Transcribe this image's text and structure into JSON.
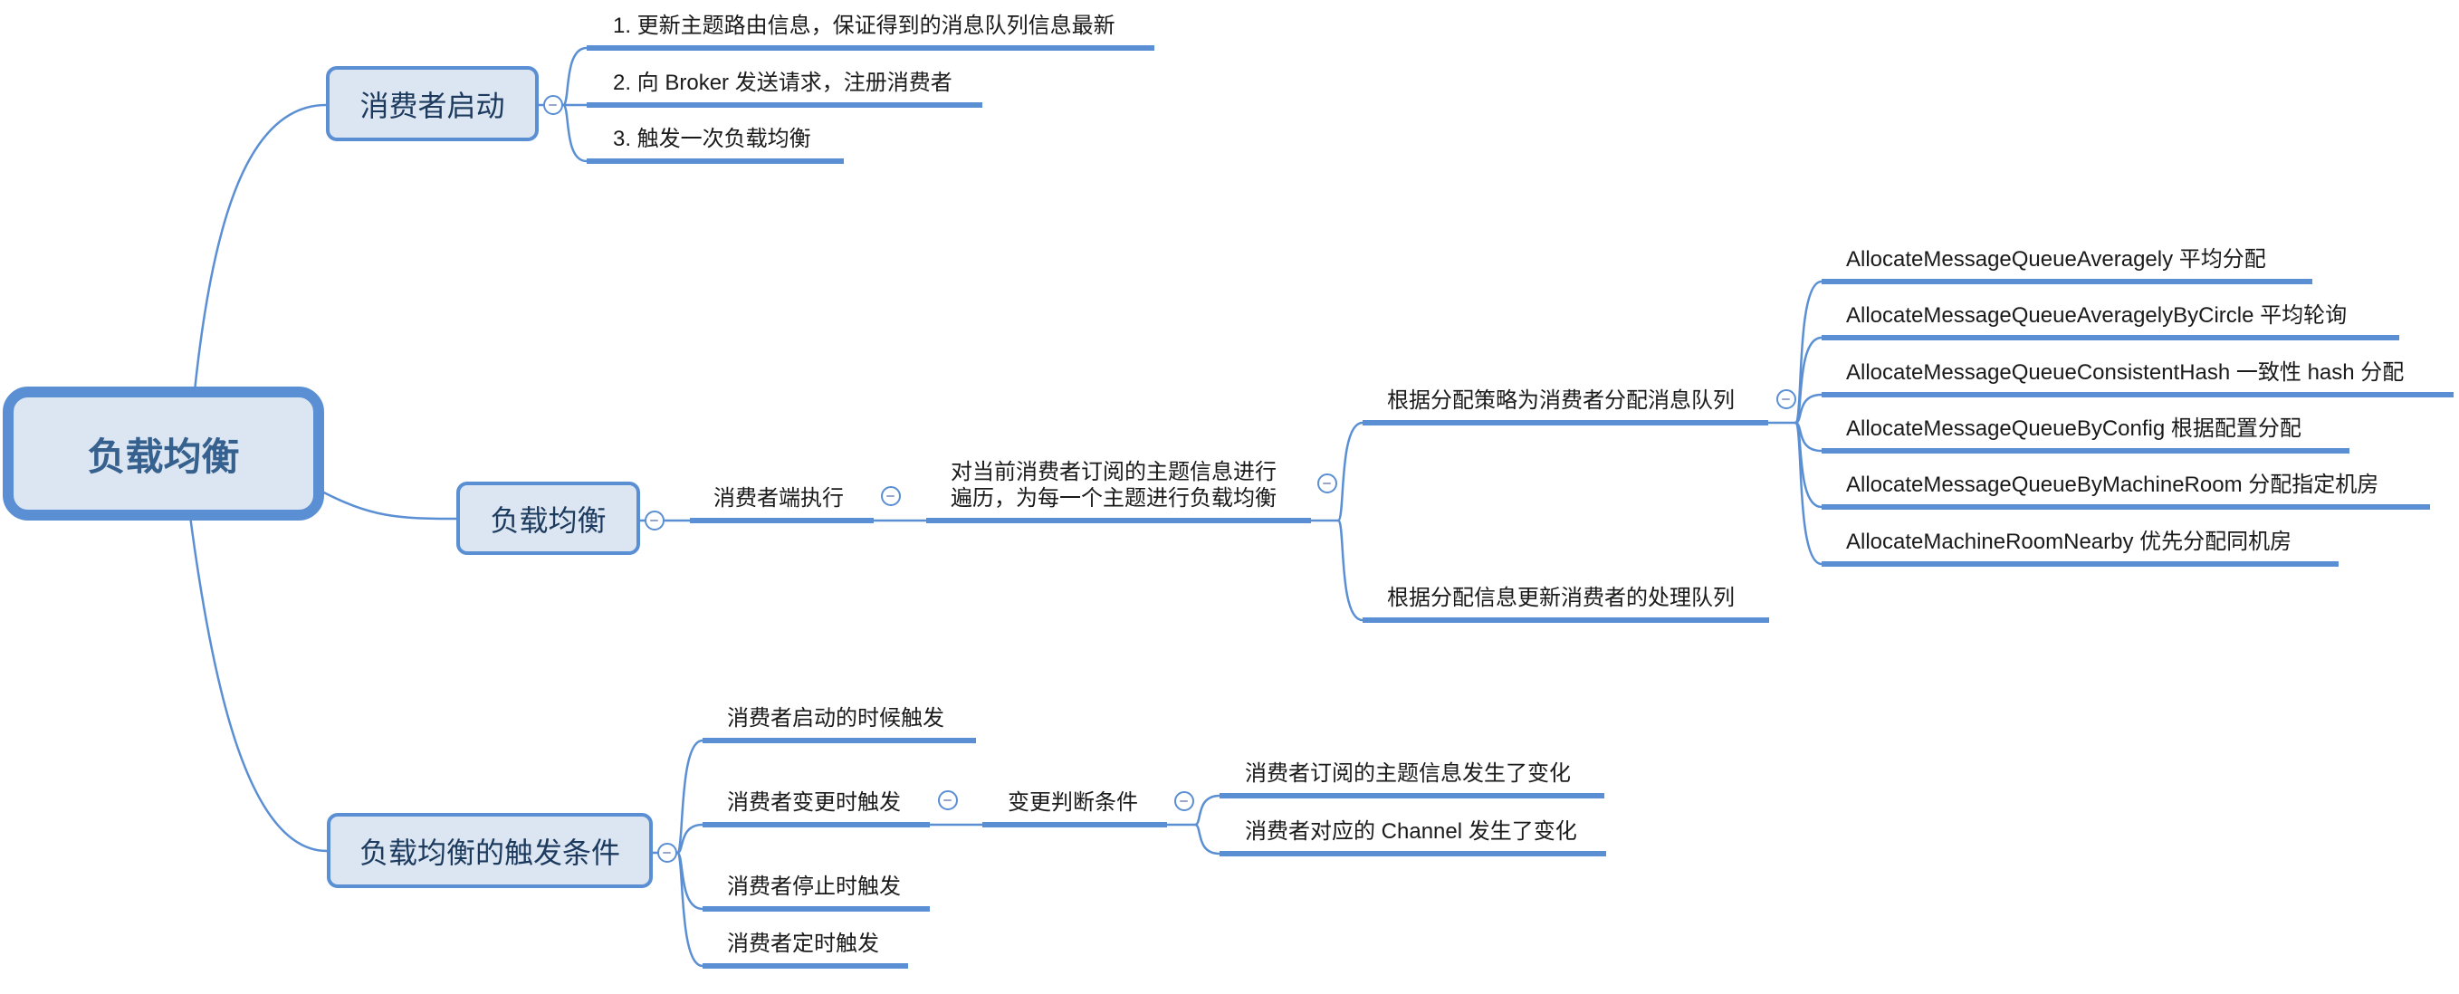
{
  "mindmap": {
    "root": {
      "label": "负载均衡"
    },
    "consumer_startup": {
      "label": "消费者启动",
      "steps": [
        "1. 更新主题路由信息，保证得到的消息队列信息最新",
        "2. 向 Broker 发送请求，注册消费者",
        "3. 触发一次负载均衡"
      ]
    },
    "load_balancing": {
      "label": "负载均衡",
      "executor": "消费者端执行",
      "traverse_lines": [
        "对当前消费者订阅的主题信息进行",
        "遍历，为每一个主题进行负载均衡"
      ],
      "allocate": {
        "label": "根据分配策略为消费者分配消息队列",
        "strategies": [
          "AllocateMessageQueueAveragely 平均分配",
          "AllocateMessageQueueAveragelyByCircle 平均轮询",
          "AllocateMessageQueueConsistentHash 一致性 hash 分配",
          "AllocateMessageQueueByConfig 根据配置分配",
          "AllocateMessageQueueByMachineRoom 分配指定机房",
          "AllocateMachineRoomNearby 优先分配同机房"
        ]
      },
      "update": "根据分配信息更新消费者的处理队列"
    },
    "triggers": {
      "label": "负载均衡的触发条件",
      "items": [
        "消费者启动的时候触发",
        "消费者变更时触发",
        "消费者停止时触发",
        "消费者定时触发"
      ],
      "change_condition": {
        "label": "变更判断条件",
        "items": [
          "消费者订阅的主题信息发生了变化",
          "消费者对应的 Channel 发生了变化"
        ]
      }
    }
  },
  "theme": {
    "line_color": "#5b8fd4",
    "node_fill": "#dce6f2",
    "node_text": "#1c3a5e",
    "root_text": "#36618f",
    "text": "#1a1a1a",
    "collapse_minus": "#9aa3c9"
  },
  "icons": {
    "collapse_button": "collapse-minus-icon"
  }
}
